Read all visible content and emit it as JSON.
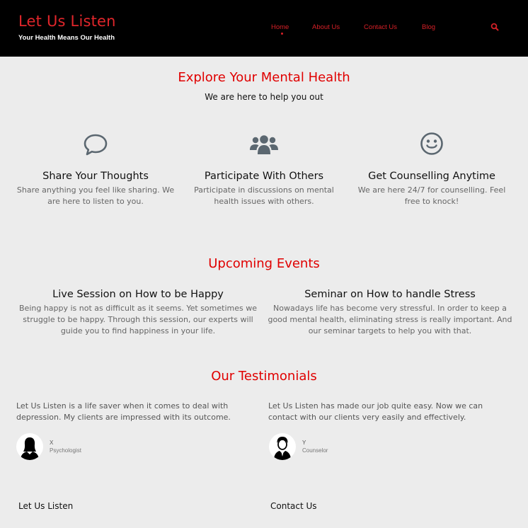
{
  "header": {
    "brand_title": "Let Us Listen",
    "brand_tagline": "Your Health Means Our Health",
    "nav": [
      {
        "label": "Home",
        "active": true
      },
      {
        "label": "About Us",
        "active": false
      },
      {
        "label": "Contact Us",
        "active": false
      },
      {
        "label": "Blog",
        "active": false
      }
    ],
    "search_icon": "search-icon"
  },
  "explore": {
    "title": "Explore Your Mental Health",
    "subtitle": "We are here to help you out",
    "features": [
      {
        "icon": "speech-bubble-icon",
        "title": "Share Your Thoughts",
        "text": "Share anything you feel like sharing. We are here to listen to you."
      },
      {
        "icon": "users-icon",
        "title": "Participate With Others",
        "text": "Participate in discussions on mental health issues with others."
      },
      {
        "icon": "smile-icon",
        "title": "Get Counselling Anytime",
        "text": "We are here 24/7 for counselling. Feel free to knock!"
      }
    ]
  },
  "events": {
    "title": "Upcoming Events",
    "items": [
      {
        "title": "Live Session on How to be Happy",
        "text": "Being happy is not as difficult as it seems. Yet sometimes we struggle to be happy. Through this session, our experts will guide you to find happiness in your life."
      },
      {
        "title": "Seminar on How to handle Stress",
        "text": "Nowadays life has become very stressful. In order to keep a good mental health, eliminating stress is really important. And our seminar targets to help you with that."
      }
    ]
  },
  "testimonials": {
    "title": "Our Testimonials",
    "items": [
      {
        "quote": "Let Us Listen is a life saver when it comes to deal with depression. My clients are impressed with its outcome.",
        "name": "X",
        "role": "Psychologist",
        "avatar": "female-avatar-icon"
      },
      {
        "quote": "Let Us Listen has made our job quite easy. Now we can contact with our clients very easily and effectively.",
        "name": "Y",
        "role": "Counselor",
        "avatar": "male-avatar-icon"
      }
    ]
  },
  "footer": {
    "col1_title": "Let Us Listen",
    "col2_title": "Contact Us"
  },
  "colors": {
    "header_bg": "#000000",
    "accent_red": "#e00000",
    "page_bg": "#ececec",
    "icon_gray": "#5b6770"
  }
}
